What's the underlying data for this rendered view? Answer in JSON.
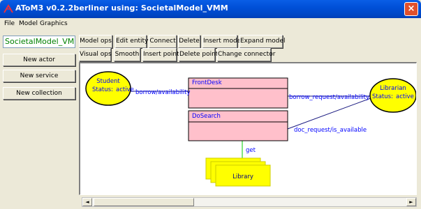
{
  "window": {
    "title": "AToM3 v0.2.2berliner using: SocietalModel_VMM",
    "close_label": "×"
  },
  "menu": [
    "File",
    "Model",
    "Graphics"
  ],
  "model_name": "SocietalModel_VMM",
  "side_buttons": [
    "New actor",
    "New service",
    "New collection"
  ],
  "toolbar_row1": [
    "Model ops",
    "Edit entity",
    "Connect",
    "Delete",
    "Insert model",
    "Expand model"
  ],
  "toolbar_row2": [
    "Visual ops",
    "Smooth",
    "Insert point",
    "Delete point",
    "Change connector"
  ],
  "diagram": {
    "actors": [
      {
        "name": "Student",
        "status_label": "Status:",
        "status_value": "active"
      },
      {
        "name": "Librarian",
        "status_label": "Status:",
        "status_value": "active"
      }
    ],
    "services": [
      "FrontDesk",
      "DoSearch"
    ],
    "collection": "Library",
    "connections": [
      {
        "label": "borrow/availability"
      },
      {
        "label": "borrow_request/availability"
      },
      {
        "label": "doc_request/is_available"
      },
      {
        "label": "get"
      }
    ],
    "colors": {
      "actor_fill": "#ffff00",
      "service_fill": "#ffc0cb",
      "collection_fill": "#ffff00",
      "label_color": "#0000ff",
      "title_color": "#0000ff",
      "get_line": "#00cc00",
      "connector": "#1a1a80"
    }
  },
  "scroll": {
    "left_arrow": "◄",
    "right_arrow": "►"
  }
}
